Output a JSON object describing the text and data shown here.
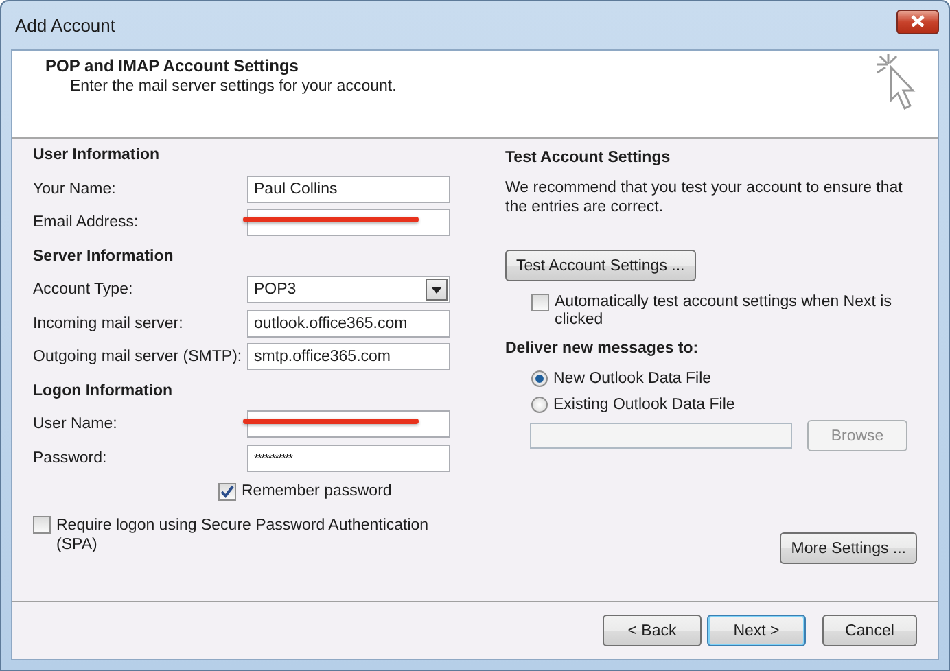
{
  "window": {
    "title": "Add Account"
  },
  "header": {
    "title": "POP and IMAP Account Settings",
    "subtitle": "Enter the mail server settings for your account."
  },
  "sections": [
    {
      "heading": "User Information",
      "fields": [
        {
          "label": "Your Name:",
          "kind": "text",
          "value": "Paul Collins"
        },
        {
          "label": "Email Address:",
          "kind": "redacted"
        }
      ]
    },
    {
      "heading": "Server Information",
      "fields": [
        {
          "label": "Account Type:",
          "kind": "select",
          "value": "POP3"
        },
        {
          "label": "Incoming mail server:",
          "kind": "text",
          "value": "outlook.office365.com"
        },
        {
          "label": "Outgoing mail server (SMTP):",
          "kind": "text",
          "value": "smtp.office365.com"
        }
      ]
    },
    {
      "heading": "Logon Information",
      "fields": [
        {
          "label": "User Name:",
          "kind": "redacted"
        },
        {
          "label": "Password:",
          "kind": "password",
          "value": "***********"
        }
      ]
    }
  ],
  "remember_password": {
    "label": "Remember password",
    "checked": true
  },
  "require_spa": {
    "label": "Require logon using Secure Password Authentication (SPA)",
    "checked": false
  },
  "test": {
    "heading": "Test Account Settings",
    "text": "We recommend that you test your account to ensure that the entries are correct.",
    "button": "Test Account Settings ...",
    "auto_test": {
      "label": "Automatically test account settings when Next is clicked",
      "checked": false
    }
  },
  "deliver": {
    "heading": "Deliver new messages to:",
    "options": [
      {
        "label": "New Outlook Data File",
        "selected": true
      },
      {
        "label": "Existing Outlook Data File",
        "selected": false
      }
    ],
    "path_field": {
      "disabled": true
    },
    "browse": {
      "label": "Browse",
      "disabled": true
    }
  },
  "more_settings": "More Settings ...",
  "buttons": [
    {
      "label": "< Back",
      "default": false
    },
    {
      "label": "Next >",
      "default": true
    },
    {
      "label": "Cancel",
      "default": false
    }
  ]
}
